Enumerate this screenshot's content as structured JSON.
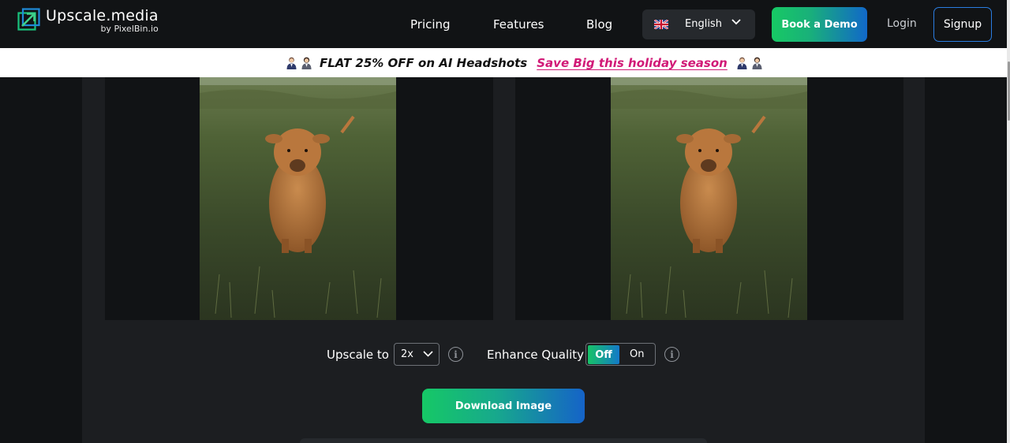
{
  "header": {
    "logo_title": "Upscale.media",
    "logo_sub": "by PixelBin.io",
    "nav": {
      "pricing": "Pricing",
      "features": "Features",
      "blog": "Blog"
    },
    "language": "English",
    "book_demo": "Book a Demo",
    "login": "Login",
    "signup": "Signup"
  },
  "banner": {
    "text": "FLAT 25% OFF on AI Headshots",
    "link": "Save Big this holiday season"
  },
  "controls": {
    "upscale_label": "Upscale to",
    "upscale_value": "2x",
    "enhance_label": "Enhance Quality",
    "toggle_off": "Off",
    "toggle_on": "On",
    "info_glyph": "i"
  },
  "download_label": "Download Image",
  "colors": {
    "accent_green": "#17c964",
    "accent_blue": "#1168c9",
    "promo_pink": "#d11a77",
    "panel_bg": "#1c1e21",
    "page_bg": "#111315"
  },
  "icons": [
    "logo-icon",
    "uk-flag-icon",
    "chevron-down-icon",
    "info-icon",
    "person-icon"
  ]
}
